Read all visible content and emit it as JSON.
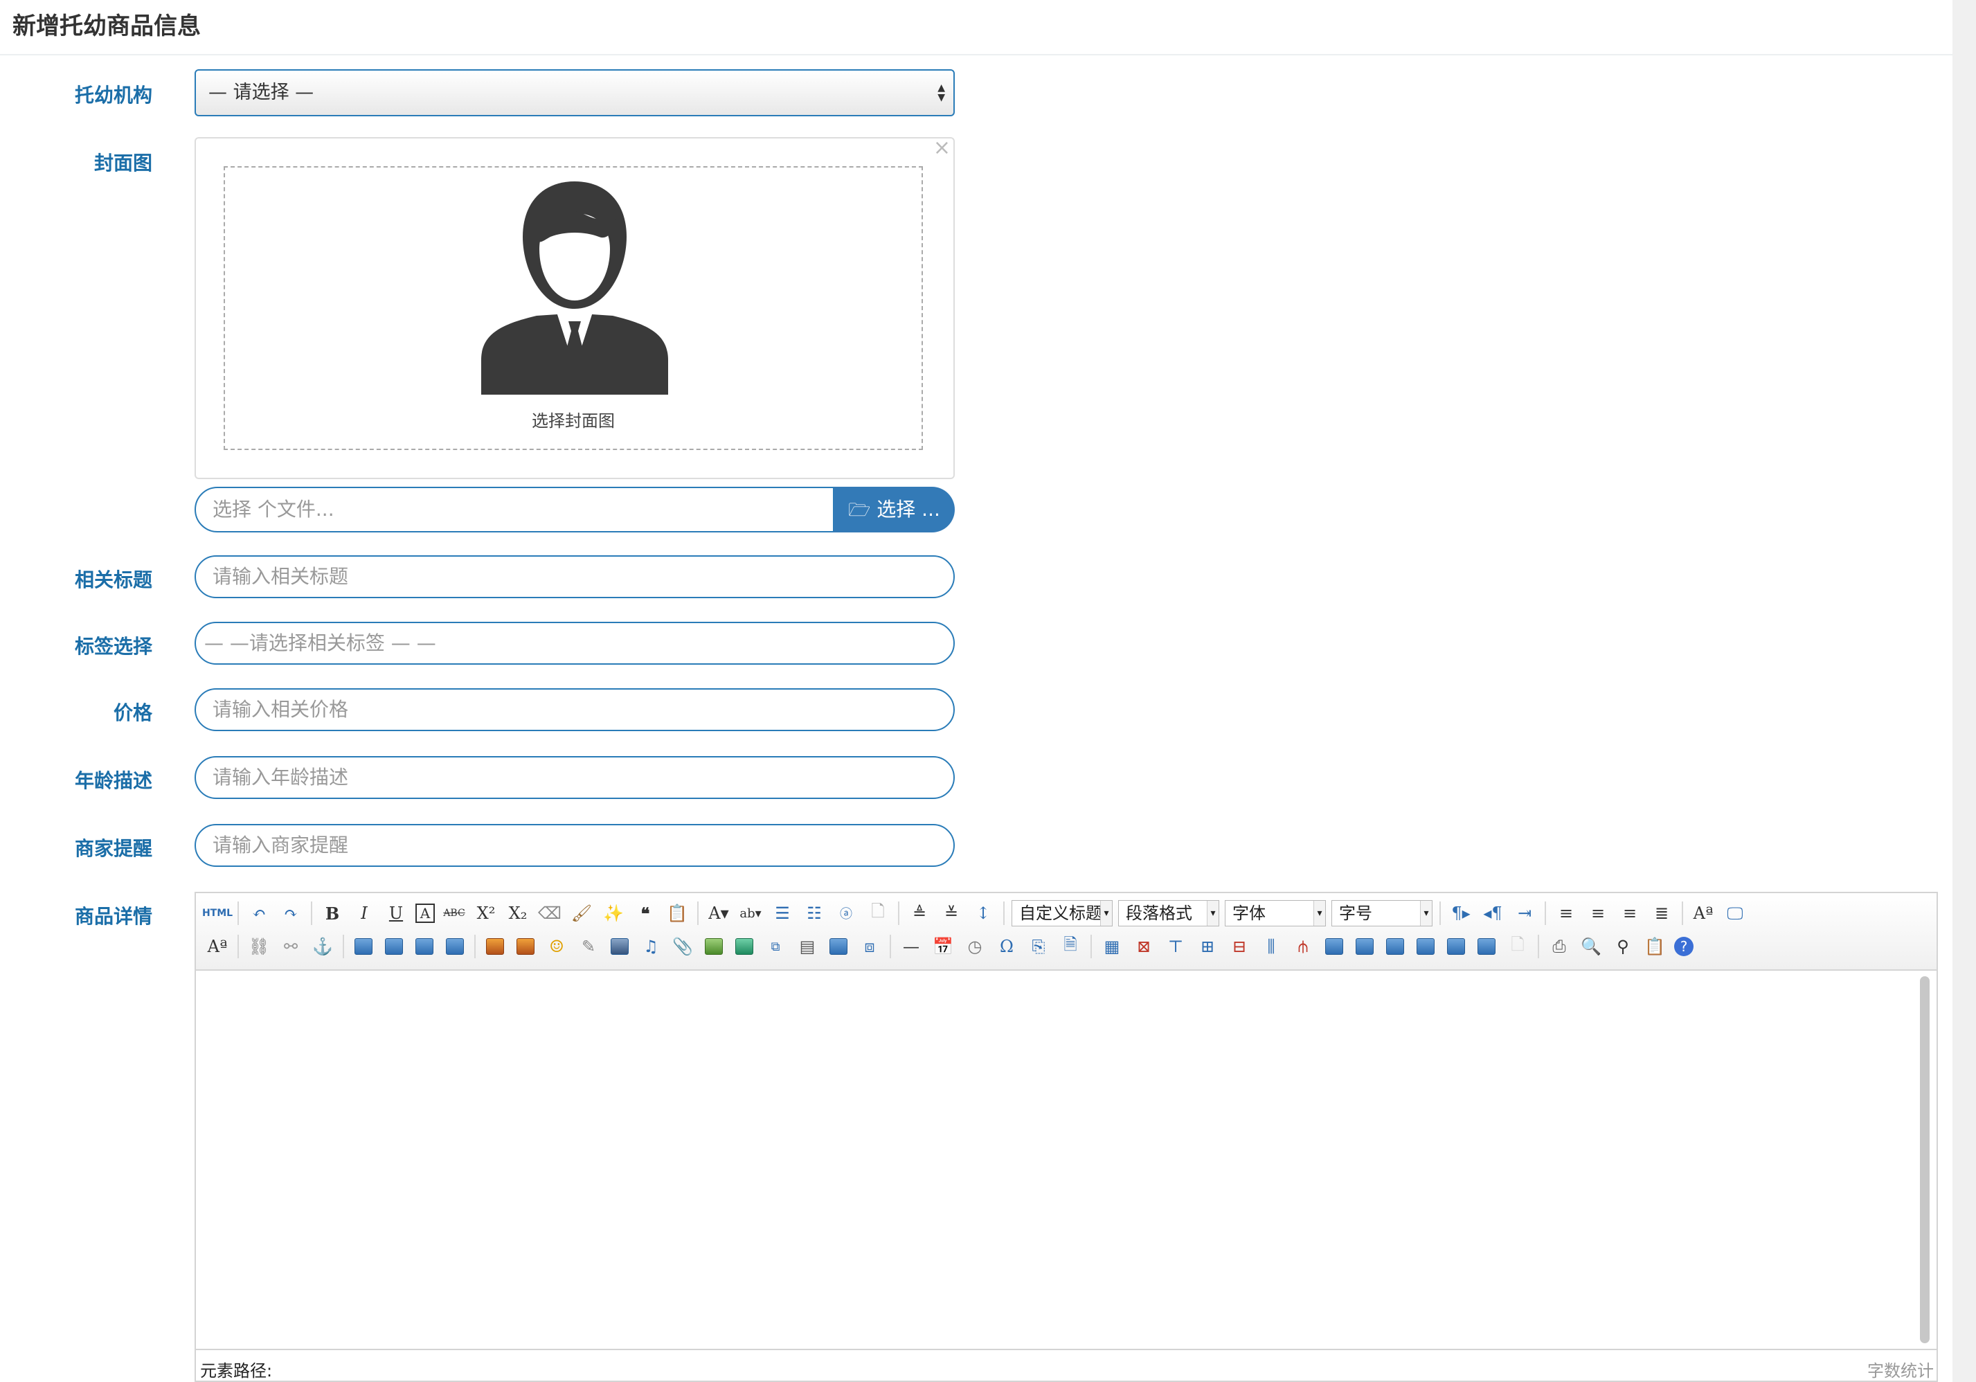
{
  "header": {
    "title": "新增托幼商品信息"
  },
  "form": {
    "institution": {
      "label": "托幼机构",
      "value": "— 请选择 —"
    },
    "cover": {
      "label": "封面图",
      "caption": "选择封面图",
      "close": "×"
    },
    "file": {
      "placeholder": "选择 个文件...",
      "button": "选择 ..."
    },
    "title": {
      "label": "相关标题",
      "placeholder": "请输入相关标题"
    },
    "tags": {
      "label": "标签选择",
      "placeholder": "— —请选择相关标签 — —"
    },
    "price": {
      "label": "价格",
      "placeholder": "请输入相关价格"
    },
    "age": {
      "label": "年龄描述",
      "placeholder": "请输入年龄描述"
    },
    "reminder": {
      "label": "商家提醒",
      "placeholder": "请输入商家提醒"
    },
    "details": {
      "label": "商品详情"
    }
  },
  "editor": {
    "html_label": "HTML",
    "combos": {
      "custom_title": "自定义标题",
      "paragraph": "段落格式",
      "font": "字体",
      "size": "字号"
    },
    "status_path": "元素路径:",
    "word_count": "字数统计"
  }
}
